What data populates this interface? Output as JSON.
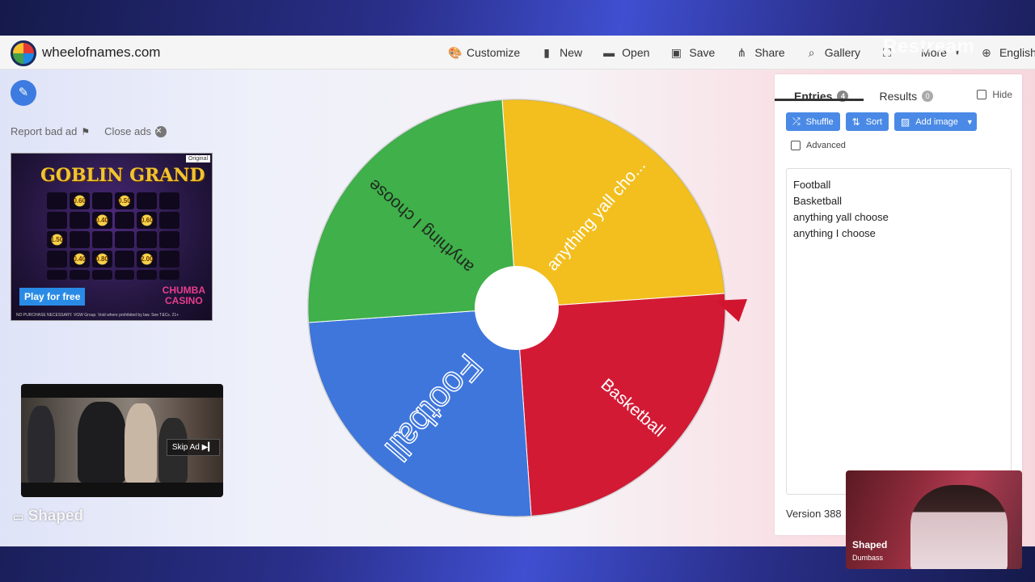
{
  "header": {
    "site_title": "wheelofnames.com",
    "menu": [
      {
        "label": "Customize",
        "icon": "palette-icon",
        "glyph": "🎨"
      },
      {
        "label": "New",
        "icon": "file-icon",
        "glyph": "▮"
      },
      {
        "label": "Open",
        "icon": "folder-icon",
        "glyph": "▬"
      },
      {
        "label": "Save",
        "icon": "floppy-icon",
        "glyph": "▣"
      },
      {
        "label": "Share",
        "icon": "share-icon",
        "glyph": "⋔"
      },
      {
        "label": "Gallery",
        "icon": "search-icon",
        "glyph": "⌕"
      }
    ],
    "more_label": "More",
    "language": "English",
    "watermark": "Restream"
  },
  "left": {
    "report_ad": "Report bad ad",
    "close_ads": "Close ads",
    "ad": {
      "title": "GOBLIN GRAND",
      "tag": "Original",
      "cta": "Play for free",
      "brand_line1": "CHUMBA",
      "brand_line2": "CASINO",
      "fine_print": "NO PURCHASE NECESSARY. VGW Group. Void where prohibited by law. See T&Cs. 21+",
      "slots": [
        "",
        "0.60",
        "",
        "0.50",
        "",
        "",
        "",
        "",
        "0.40",
        "",
        "0.60",
        "",
        "1.50",
        "",
        "",
        "",
        "",
        "",
        "",
        "0.40",
        "0.80",
        "",
        "2.00",
        "",
        "",
        "",
        "",
        "",
        "",
        ""
      ]
    },
    "video_ad": {
      "skip_label": "Skip Ad"
    },
    "overlay_label": "Shaped"
  },
  "wheel": {
    "segments": [
      {
        "label": "anything yall cho...",
        "color": "#f2bf1f"
      },
      {
        "label": "Basketball",
        "color": "#d31a35"
      },
      {
        "label": "Football",
        "color": "#3f76dc"
      },
      {
        "label": "anything I choose",
        "color": "#3fb04a"
      }
    ],
    "pointer_color": "#d2152e"
  },
  "panel": {
    "tabs": [
      {
        "label": "Entries",
        "count": "4"
      },
      {
        "label": "Results",
        "count": "0"
      }
    ],
    "hide_label": "Hide",
    "buttons": {
      "shuffle": "Shuffle",
      "sort": "Sort",
      "add_image": "Add image"
    },
    "advanced_label": "Advanced",
    "entries": [
      "Football",
      "Basketball",
      "anything yall choose",
      "anything I choose"
    ],
    "version": "Version 388"
  },
  "webcam": {
    "name": "Shaped",
    "subtitle": "Dumbass"
  }
}
